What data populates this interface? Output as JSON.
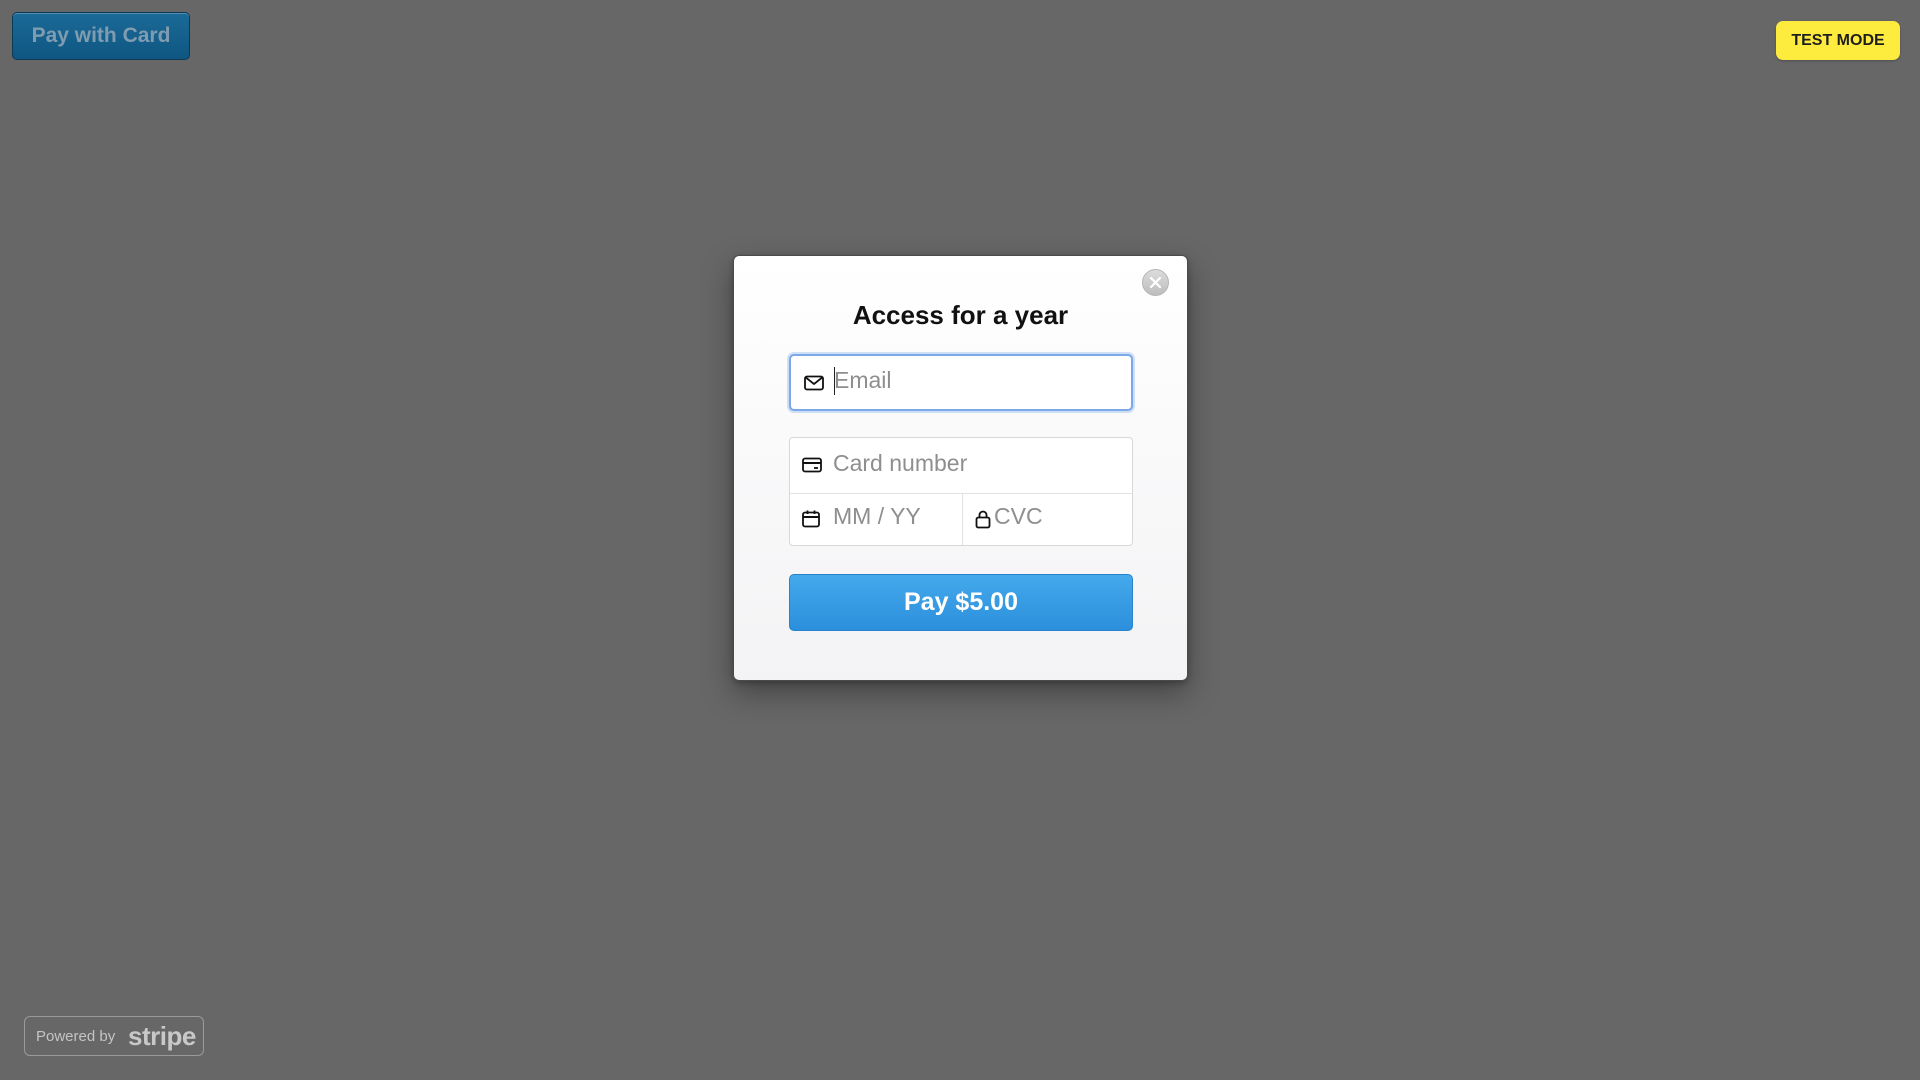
{
  "page": {
    "background_color": "#676767"
  },
  "top_button": {
    "label": "Pay with Card"
  },
  "badge": {
    "label": "TEST MODE",
    "color": "#fdeb3d"
  },
  "modal": {
    "title": "Access for a year",
    "close_icon": "close-icon",
    "email": {
      "placeholder": "Email",
      "value": "",
      "icon": "envelope-icon"
    },
    "card_number": {
      "placeholder": "Card number",
      "value": "",
      "icon": "credit-card-icon"
    },
    "expiry": {
      "placeholder": "MM / YY",
      "value": "",
      "icon": "calendar-icon"
    },
    "cvc": {
      "placeholder": "CVC",
      "value": "",
      "icon": "lock-icon"
    },
    "pay_button": {
      "label": "Pay $5.00",
      "color": "#3a9de6"
    }
  },
  "footer": {
    "powered_by": "Powered by",
    "brand": "stripe"
  }
}
